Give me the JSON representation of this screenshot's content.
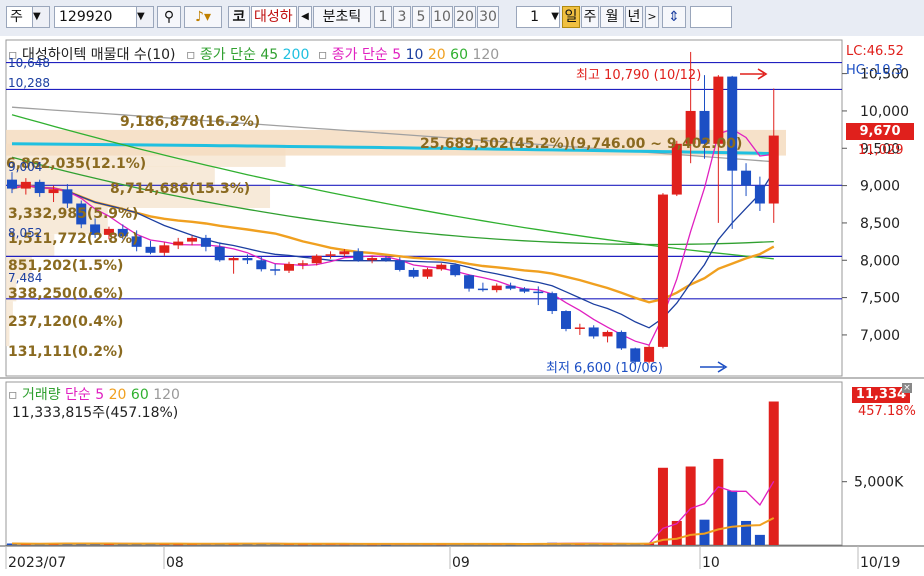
{
  "toolbar": {
    "market": "주",
    "code": "129920",
    "code_btn": "코",
    "stock_name": "대성하이텍",
    "min_tick": "분초틱",
    "intervals": [
      "1",
      "3",
      "5",
      "10",
      "20",
      "30"
    ],
    "count": "1",
    "periods": [
      "일",
      "주",
      "월",
      "년"
    ],
    "active_period": "일"
  },
  "price_legend": {
    "title": "대성하이텍 매물대 수(10)",
    "ma_long_label": "종가 단순",
    "ma_long_values": [
      "45",
      "200"
    ],
    "ma_short_label": "종가 단순",
    "ma_short_values": [
      "5",
      "10",
      "20",
      "60",
      "120"
    ]
  },
  "volume_legend": {
    "title": "거래량",
    "ma_label": "단순",
    "ma_values": [
      "5",
      "20",
      "60",
      "120"
    ],
    "current": "11,333,815주(457.18%)"
  },
  "annotations": {
    "high": "최고 10,790 (10/12)",
    "low": "최저 6,600 (10/06)",
    "lc": "LC:46.52",
    "hc": "HC:-10.3",
    "left_top1": "10,648",
    "left_top2": "10,288",
    "left_mid1": "9,004",
    "left_mid2": "8,052",
    "left_mid3": "7,484"
  },
  "price_tags": {
    "last_price": "9,670",
    "prev": "11,029",
    "volume_last": "11,334",
    "volume_pct": "457.18%"
  },
  "colors": {
    "up": "#e0201c",
    "down": "#1c4fc4",
    "ma5": "#e020c0",
    "ma10": "#1c3fa0",
    "ma20": "#f0a020",
    "ma60": "#30b030",
    "ma120": "#a0a0a0",
    "ma45": "#30a030",
    "ma200": "#20c0e0",
    "hline": "#2020c0"
  },
  "chart_data": [
    {
      "type": "candlestick",
      "title": "대성하이텍 매물대 수(10)",
      "ylim": [
        6450,
        10950
      ],
      "y_ticks": [
        7000,
        7500,
        8000,
        8500,
        9000,
        9500,
        10000,
        10500
      ],
      "x_ticks": [
        "2023/07",
        "08",
        "09",
        "10",
        "10/19"
      ],
      "reference_lines": [
        10648,
        10288,
        9004,
        8052,
        7484
      ],
      "volume_profile": [
        {
          "label": "9,186,878(16.2%)",
          "volume": 9186878,
          "pct": 16.2
        },
        {
          "label": "25,689,502(45.2%)(9,746.00 ~ 9,402.00)",
          "volume": 25689502,
          "pct": 45.2
        },
        {
          "label": "6,862,035(12.1%)",
          "volume": 6862035,
          "pct": 12.1
        },
        {
          "label": "8,714,686(15.3%)",
          "volume": 8714686,
          "pct": 15.3
        },
        {
          "label": "3,332,985(5.9%)",
          "volume": 3332985,
          "pct": 5.9
        },
        {
          "label": "1,511,772(2.8%)",
          "volume": 1511772,
          "pct": 2.8
        },
        {
          "label": "851,202(1.5%)",
          "volume": 851202,
          "pct": 1.5
        },
        {
          "label": "338,250(0.6%)",
          "volume": 338250,
          "pct": 0.6
        },
        {
          "label": "237,120(0.4%)",
          "volume": 237120,
          "pct": 0.4
        },
        {
          "label": "131,111(0.2%)",
          "volume": 131111,
          "pct": 0.2
        }
      ],
      "candles": [
        {
          "o": 9080,
          "h": 9180,
          "l": 8900,
          "c": 8960
        },
        {
          "o": 8960,
          "h": 9100,
          "l": 8880,
          "c": 9050
        },
        {
          "o": 9050,
          "h": 9080,
          "l": 8850,
          "c": 8900
        },
        {
          "o": 8900,
          "h": 9000,
          "l": 8780,
          "c": 8950
        },
        {
          "o": 8950,
          "h": 9020,
          "l": 8700,
          "c": 8760
        },
        {
          "o": 8760,
          "h": 8800,
          "l": 8430,
          "c": 8480
        },
        {
          "o": 8480,
          "h": 8560,
          "l": 8300,
          "c": 8340
        },
        {
          "o": 8340,
          "h": 8450,
          "l": 8280,
          "c": 8420
        },
        {
          "o": 8420,
          "h": 8480,
          "l": 8280,
          "c": 8320
        },
        {
          "o": 8320,
          "h": 8400,
          "l": 8120,
          "c": 8180
        },
        {
          "o": 8180,
          "h": 8260,
          "l": 8080,
          "c": 8100
        },
        {
          "o": 8100,
          "h": 8240,
          "l": 8060,
          "c": 8200
        },
        {
          "o": 8200,
          "h": 8300,
          "l": 8150,
          "c": 8250
        },
        {
          "o": 8250,
          "h": 8330,
          "l": 8200,
          "c": 8300
        },
        {
          "o": 8300,
          "h": 8340,
          "l": 8120,
          "c": 8180
        },
        {
          "o": 8180,
          "h": 8240,
          "l": 7980,
          "c": 8000
        },
        {
          "o": 8000,
          "h": 8050,
          "l": 7820,
          "c": 8030
        },
        {
          "o": 8030,
          "h": 8080,
          "l": 7950,
          "c": 8000
        },
        {
          "o": 8000,
          "h": 8050,
          "l": 7850,
          "c": 7880
        },
        {
          "o": 7880,
          "h": 7950,
          "l": 7800,
          "c": 7860
        },
        {
          "o": 7860,
          "h": 7980,
          "l": 7830,
          "c": 7950
        },
        {
          "o": 7950,
          "h": 8000,
          "l": 7880,
          "c": 7960
        },
        {
          "o": 7960,
          "h": 8080,
          "l": 7930,
          "c": 8060
        },
        {
          "o": 8060,
          "h": 8120,
          "l": 8020,
          "c": 8080
        },
        {
          "o": 8080,
          "h": 8150,
          "l": 8050,
          "c": 8120
        },
        {
          "o": 8120,
          "h": 8160,
          "l": 7980,
          "c": 8000
        },
        {
          "o": 8000,
          "h": 8060,
          "l": 7960,
          "c": 8030
        },
        {
          "o": 8030,
          "h": 8060,
          "l": 7980,
          "c": 8000
        },
        {
          "o": 8000,
          "h": 8040,
          "l": 7850,
          "c": 7870
        },
        {
          "o": 7870,
          "h": 7900,
          "l": 7760,
          "c": 7780
        },
        {
          "o": 7780,
          "h": 7900,
          "l": 7750,
          "c": 7880
        },
        {
          "o": 7880,
          "h": 7960,
          "l": 7860,
          "c": 7940
        },
        {
          "o": 7940,
          "h": 7960,
          "l": 7780,
          "c": 7800
        },
        {
          "o": 7800,
          "h": 7810,
          "l": 7580,
          "c": 7620
        },
        {
          "o": 7620,
          "h": 7700,
          "l": 7580,
          "c": 7600
        },
        {
          "o": 7600,
          "h": 7690,
          "l": 7570,
          "c": 7660
        },
        {
          "o": 7660,
          "h": 7700,
          "l": 7600,
          "c": 7620
        },
        {
          "o": 7620,
          "h": 7640,
          "l": 7560,
          "c": 7580
        },
        {
          "o": 7580,
          "h": 7650,
          "l": 7400,
          "c": 7560
        },
        {
          "o": 7560,
          "h": 7580,
          "l": 7280,
          "c": 7320
        },
        {
          "o": 7320,
          "h": 7330,
          "l": 7050,
          "c": 7080
        },
        {
          "o": 7080,
          "h": 7150,
          "l": 7000,
          "c": 7100
        },
        {
          "o": 7100,
          "h": 7130,
          "l": 6950,
          "c": 6980
        },
        {
          "o": 6980,
          "h": 7060,
          "l": 6900,
          "c": 7040
        },
        {
          "o": 7040,
          "h": 7060,
          "l": 6800,
          "c": 6820
        },
        {
          "o": 6820,
          "h": 6830,
          "l": 6600,
          "c": 6640
        },
        {
          "o": 6640,
          "h": 6860,
          "l": 6620,
          "c": 6840
        },
        {
          "o": 6840,
          "h": 8900,
          "l": 6820,
          "c": 8880
        },
        {
          "o": 8880,
          "h": 9600,
          "l": 8860,
          "c": 9560
        },
        {
          "o": 9560,
          "h": 10790,
          "l": 9300,
          "c": 10000
        },
        {
          "o": 10000,
          "h": 10480,
          "l": 9360,
          "c": 9560
        },
        {
          "o": 9560,
          "h": 10480,
          "l": 8500,
          "c": 10460
        },
        {
          "o": 10460,
          "h": 10470,
          "l": 8420,
          "c": 9200
        },
        {
          "o": 9200,
          "h": 9300,
          "l": 8860,
          "c": 9000
        },
        {
          "o": 9000,
          "h": 9120,
          "l": 8660,
          "c": 8760
        },
        {
          "o": 8760,
          "h": 10300,
          "l": 8500,
          "c": 9670
        }
      ],
      "volume": [
        120000,
        100000,
        90000,
        110000,
        150000,
        160000,
        100000,
        80000,
        90000,
        110000,
        90000,
        80000,
        70000,
        80000,
        90000,
        120000,
        140000,
        100000,
        110000,
        90000,
        80000,
        70000,
        90000,
        80000,
        70000,
        80000,
        70000,
        60000,
        90000,
        100000,
        80000,
        70000,
        90000,
        120000,
        90000,
        80000,
        70000,
        80000,
        150000,
        180000,
        160000,
        100000,
        90000,
        80000,
        150000,
        120000,
        130000,
        6100000,
        1900000,
        6200000,
        2000000,
        6800000,
        4300000,
        1900000,
        800000,
        11333815
      ]
    }
  ]
}
